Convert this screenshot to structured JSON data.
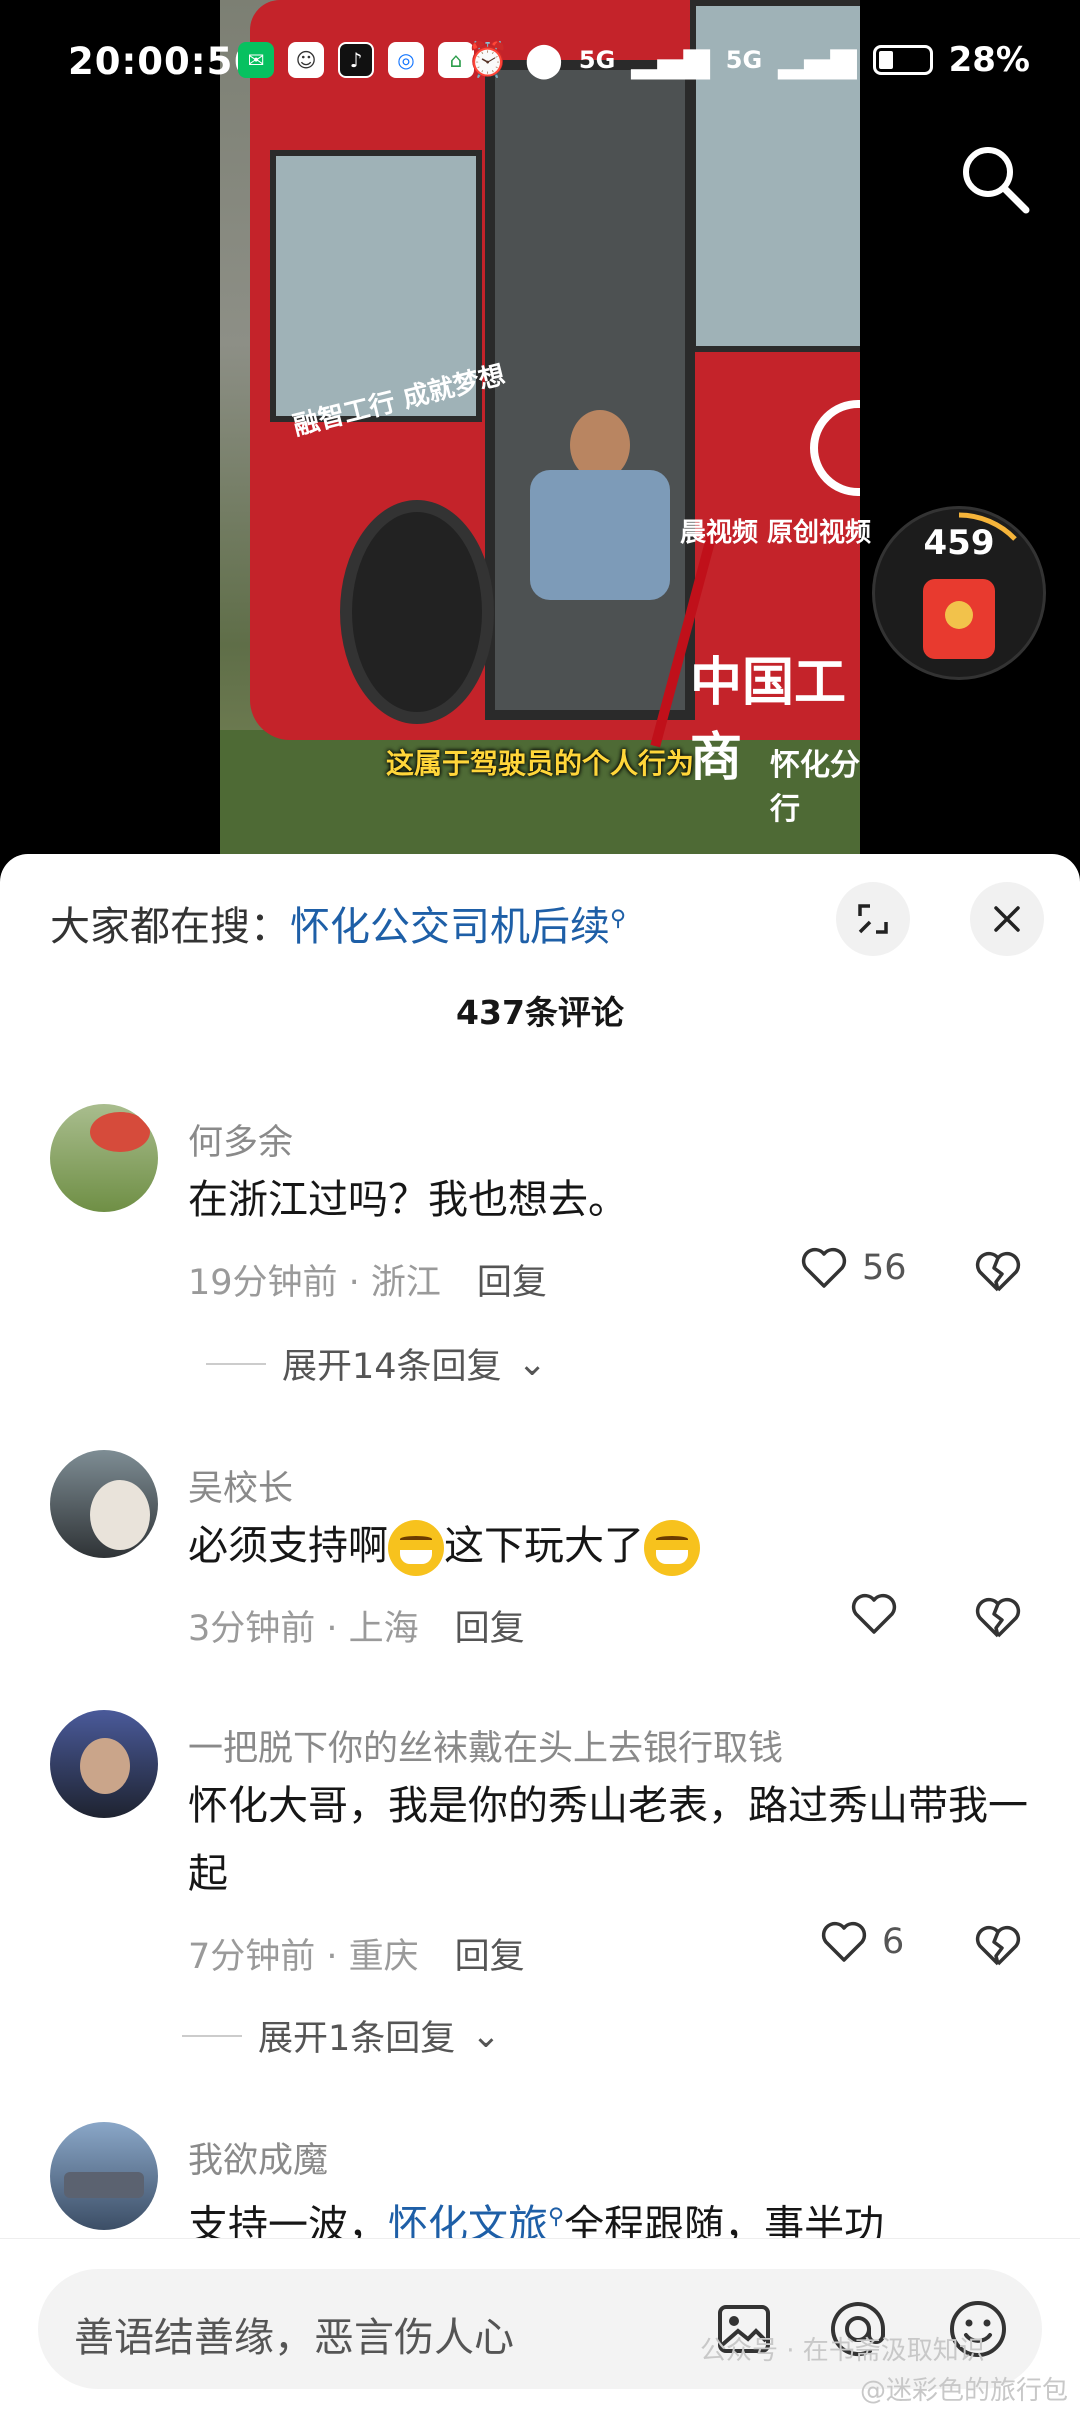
{
  "status_bar": {
    "time": "20:00:56",
    "battery": "28%",
    "network_1": "5G",
    "network_2": "5G"
  },
  "video": {
    "caption": "这属于驾驶员的个人行为",
    "watermark": "晨视频 原创视频",
    "bus_text_side": "中国工商",
    "bus_text_branch": "怀化分行",
    "bus_slogan": "融智工行 成就梦想",
    "redpacket_count": "459"
  },
  "sheet": {
    "hot_search_label": "大家都在搜：",
    "hot_search_term": "怀化公交司机后续",
    "title": "437条评论"
  },
  "comments": [
    {
      "user": "何多余",
      "text": "在浙江过吗？我也想去。",
      "meta": "19分钟前 · 浙江",
      "reply_label": "回复",
      "likes": "56",
      "expand": "展开14条回复"
    },
    {
      "user": "吴校长",
      "text_a": "必须支持啊",
      "text_b": "这下玩大了",
      "meta": "3分钟前 · 上海",
      "reply_label": "回复",
      "likes": ""
    },
    {
      "user": "一把脱下你的丝袜戴在头上去银行取钱",
      "text": "怀化大哥，我是你的秀山老表，路过秀山带我一起",
      "meta": "7分钟前 · 重庆",
      "reply_label": "回复",
      "likes": "6",
      "expand": "展开1条回复"
    },
    {
      "user": "我欲成魔",
      "text_a": "支持一波，",
      "text_link": "怀化文旅",
      "text_b": "全程跟随，事半功"
    }
  ],
  "input": {
    "placeholder": "善语结善缘，恶言伤人心"
  },
  "footer_watermark": {
    "line1": "公众号 · 在书斋汲取知识",
    "line2": "@迷彩色的旅行包"
  },
  "colors": {
    "link": "#1e5fa7",
    "bus_red": "#c4232a",
    "caption_yellow": "#ffd63a"
  }
}
